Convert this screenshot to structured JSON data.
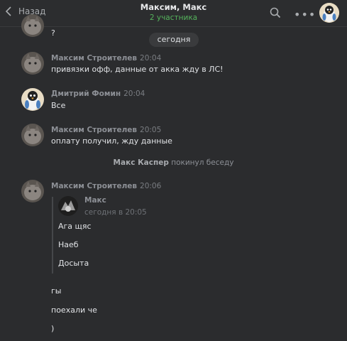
{
  "header": {
    "back_label": "Назад",
    "title": "Максим, Макс",
    "subtitle": "2 участника"
  },
  "date_divider": "сегодня",
  "messages": [
    {
      "text": "?"
    },
    {
      "author": "Максим Строителев",
      "time": "20:04",
      "text": "привязки офф, данные от акка жду в ЛС!"
    },
    {
      "author": "Дмитрий Фомин",
      "time": "20:04",
      "text": "Все"
    },
    {
      "author": "Максим Строителев",
      "time": "20:05",
      "text": "оплату получил, жду данные"
    }
  ],
  "system_message": {
    "actor": "Макс Каспер",
    "action": "покинул беседу"
  },
  "last_message": {
    "author": "Максим Строителев",
    "time": "20:06",
    "forwarded": {
      "author": "Макс",
      "date": "сегодня в 20:05",
      "lines": [
        "Ага щяс",
        "Наеб",
        "Досыта"
      ]
    },
    "lines": [
      "гы",
      "поехали че",
      ")"
    ]
  },
  "icons": {
    "back": "chevron-left-icon",
    "search": "search-icon",
    "more": "more-dots-icon"
  },
  "colors": {
    "background": "#2b2c2e",
    "online_green": "#55b35c",
    "author_gray": "#8d9096"
  }
}
